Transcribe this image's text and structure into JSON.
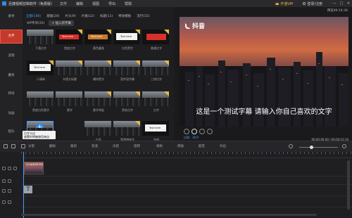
{
  "app": {
    "title": "迅捷视频剪辑软件（免费版）",
    "menu": [
      "文件",
      "编辑",
      "视图",
      "导出",
      "帮助"
    ],
    "vip_label": "开通VIP",
    "login_label": "登录/注册",
    "window_controls": [
      "—",
      "□",
      "✕"
    ]
  },
  "sidebar": {
    "items": [
      {
        "label": "素材"
      },
      {
        "label": "文字"
      },
      {
        "label": "滤镜"
      },
      {
        "label": "叠附"
      },
      {
        "label": "转场"
      },
      {
        "label": "动画"
      },
      {
        "label": "配乐"
      }
    ],
    "active_index": 1
  },
  "media": {
    "tabs": [
      "全部(106)",
      "基础(20)",
      "片头(9)",
      "片尾(12)",
      "标题(11)",
      "特效模板",
      "流行(15)"
    ],
    "active_tab": 0,
    "subtab_label": "VIP专享(25)",
    "add_button_label": "+ 插入新字幕",
    "items": [
      {
        "caption": "下落白字",
        "style": "city"
      },
      {
        "caption": "黑底白字",
        "style": "red",
        "text": "Text here",
        "vip": true
      },
      {
        "caption": "黄色圆角",
        "style": "red",
        "text": "Text here",
        "vip": true
      },
      {
        "caption": "白色黑字",
        "style": "white",
        "text": "Text here",
        "vip": true
      },
      {
        "caption": "普通文字",
        "style": "red",
        "text": "",
        "vip": true
      },
      {
        "caption": "小清新",
        "style": "white",
        "text": "Text here",
        "vip": true
      },
      {
        "caption": "半透大标题",
        "style": "city",
        "vip": true
      },
      {
        "caption": "横排黑字",
        "style": "city",
        "vip": true
      },
      {
        "caption": "宣传语字幕",
        "style": "city",
        "vip": true
      },
      {
        "caption": "三排白字",
        "style": "city",
        "vip": true
      },
      {
        "caption": "黑底白色黄字",
        "style": "city"
      },
      {
        "caption": "黄字",
        "style": "city"
      },
      {
        "caption": "黄字举起",
        "style": "city",
        "vip": true
      },
      {
        "caption": "黑条白字",
        "style": "city",
        "vip": true
      },
      {
        "caption": "白字",
        "style": "city",
        "vip": true
      },
      {
        "caption": "",
        "style": "selected"
      },
      {
        "caption": "白字",
        "style": "city"
      },
      {
        "caption": "黑透明底字",
        "style": "city",
        "vip": true
      },
      {
        "caption": "中间",
        "style": "white",
        "text": "Text here"
      }
    ],
    "tooltip": "白字卡边\n放置时将被使用来自"
  },
  "preview": {
    "top_time": "预览00:14:34",
    "brand": "抖音",
    "subtitle": "这是一个测试字幕 请输入你自己喜欢的文字",
    "zoom_label": "比例：16:9",
    "timecode": "00:00:00.00 / 00:00:10.10"
  },
  "toolbar": {
    "tools": [
      "分割",
      "删除",
      "裁剪",
      "变速",
      "冻结",
      "旋转",
      "调色",
      "倒放",
      "配音",
      "导出"
    ]
  },
  "timeline": {
    "clip_label": "1.mp4(00:10)",
    "text_clip_glyph": "T"
  },
  "colors": {
    "accent": "#2f8ae6",
    "active_sidebar": "#c4392c",
    "vip_gold": "#e6b84a",
    "highlight_blue": "#4aa0ff"
  }
}
